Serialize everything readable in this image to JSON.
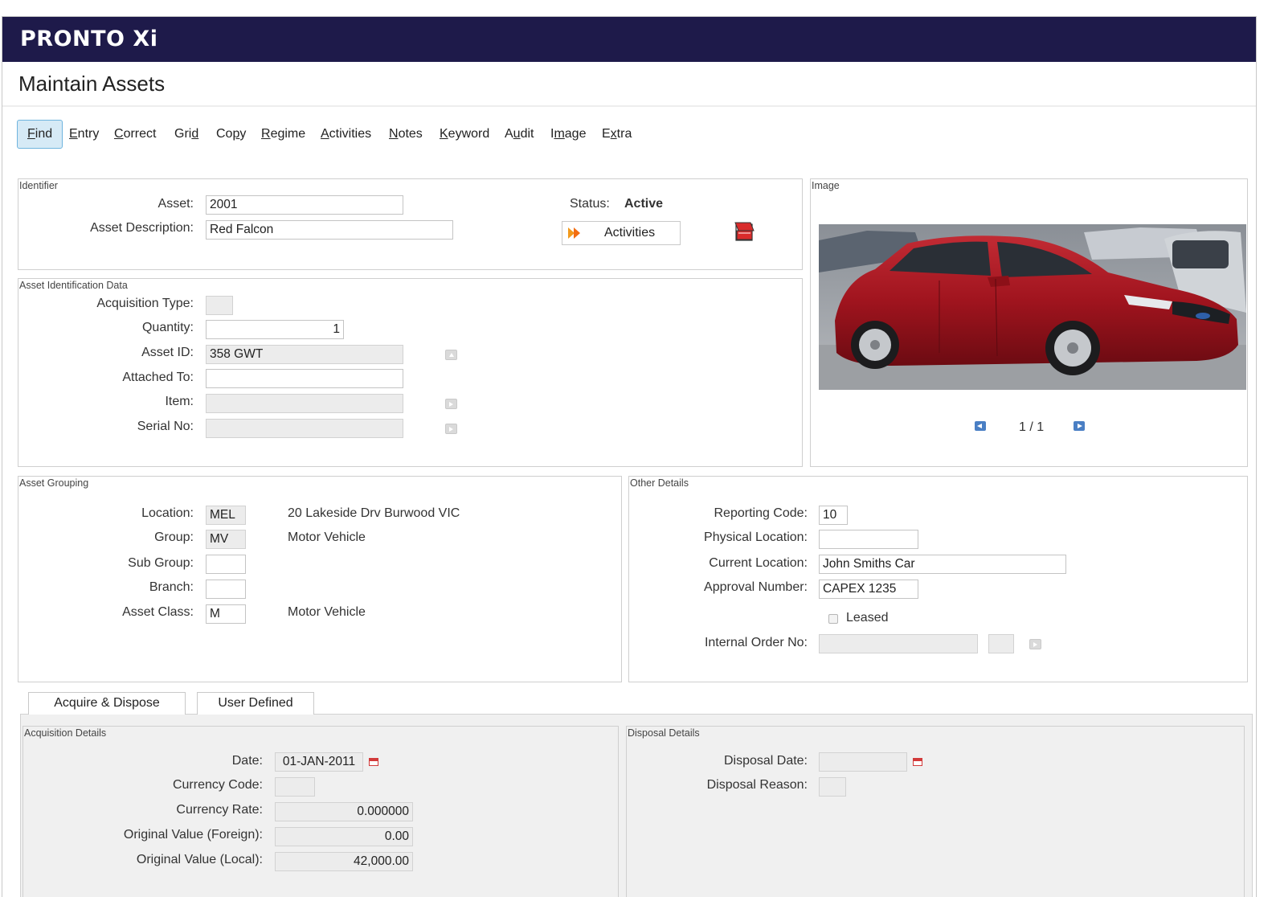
{
  "app": {
    "logo": "PRONTO Xi"
  },
  "page": {
    "title": "Maintain Assets"
  },
  "toolbar": [
    {
      "label": "Find",
      "u": "F",
      "rest": "ind",
      "pre": ""
    },
    {
      "label": "Entry",
      "pre": "",
      "u": "E",
      "rest": "ntry"
    },
    {
      "label": "Correct",
      "pre": "",
      "u": "C",
      "rest": "orrect"
    },
    {
      "label": "Grid",
      "pre": "Gri",
      "u": "d",
      "rest": ""
    },
    {
      "label": "Copy",
      "pre": "Co",
      "u": "p",
      "rest": "y"
    },
    {
      "label": "Regime",
      "pre": "",
      "u": "R",
      "rest": "egime"
    },
    {
      "label": "Activities",
      "pre": "",
      "u": "A",
      "rest": "ctivities"
    },
    {
      "label": "Notes",
      "pre": "",
      "u": "N",
      "rest": "otes"
    },
    {
      "label": "Keyword",
      "pre": "",
      "u": "K",
      "rest": "eyword"
    },
    {
      "label": "Audit",
      "pre": "A",
      "u": "u",
      "rest": "dit"
    },
    {
      "label": "Image",
      "pre": "I",
      "u": "m",
      "rest": "age"
    },
    {
      "label": "Extra",
      "pre": "E",
      "u": "x",
      "rest": "tra"
    }
  ],
  "identifier": {
    "legend": "Identifier",
    "asset_label": "Asset:",
    "asset_value": "2001",
    "desc_label": "Asset Description:",
    "desc_value": "Red Falcon",
    "status_label": "Status:",
    "status_value": "Active",
    "activities_button": "Activities"
  },
  "image_panel": {
    "legend": "Image",
    "pager": "1 / 1"
  },
  "asset_id_data": {
    "legend": "Asset Identification Data",
    "acq_type_label": "Acquisition Type:",
    "acq_type_value": "",
    "quantity_label": "Quantity:",
    "quantity_value": "1",
    "asset_id_label": "Asset ID:",
    "asset_id_value": "358 GWT",
    "attached_label": "Attached To:",
    "attached_value": "",
    "item_label": "Item:",
    "item_value": "",
    "serial_label": "Serial No:",
    "serial_value": ""
  },
  "asset_grouping": {
    "legend": "Asset Grouping",
    "location_label": "Location:",
    "location_code": "MEL",
    "location_desc": "20 Lakeside Drv Burwood VIC",
    "group_label": "Group:",
    "group_code": "MV",
    "group_desc": "Motor Vehicle",
    "subgroup_label": "Sub Group:",
    "subgroup_code": "",
    "branch_label": "Branch:",
    "branch_code": "",
    "class_label": "Asset Class:",
    "class_code": "M",
    "class_desc": "Motor Vehicle"
  },
  "other_details": {
    "legend": "Other Details",
    "reporting_label": "Reporting Code:",
    "reporting_value": "10",
    "physical_label": "Physical Location:",
    "physical_value": "",
    "current_label": "Current Location:",
    "current_value": "John Smiths Car",
    "approval_label": "Approval Number:",
    "approval_value": "CAPEX 1235",
    "leased_label": "Leased",
    "internal_order_label": "Internal Order No:",
    "internal_order_value": ""
  },
  "tabs": [
    {
      "label": "Acquire & Dispose",
      "active": true
    },
    {
      "label": "User Defined",
      "active": false
    }
  ],
  "acquisition": {
    "legend": "Acquisition Details",
    "date_label": "Date:",
    "date_value": "01-JAN-2011",
    "currency_code_label": "Currency Code:",
    "currency_code_value": "",
    "currency_rate_label": "Currency Rate:",
    "currency_rate_value": "0.000000",
    "orig_foreign_label": "Original Value (Foreign):",
    "orig_foreign_value": "0.00",
    "orig_local_label": "Original Value (Local):",
    "orig_local_value": "42,000.00"
  },
  "disposal": {
    "legend": "Disposal Details",
    "date_label": "Disposal Date:",
    "date_value": "",
    "reason_label": "Disposal Reason:",
    "reason_value": ""
  },
  "colors": {
    "topbar": "#1e1a4a",
    "active_button_bg": "#d6eaf6",
    "active_button_border": "#6fb4de",
    "car_body": "#a0141e"
  }
}
